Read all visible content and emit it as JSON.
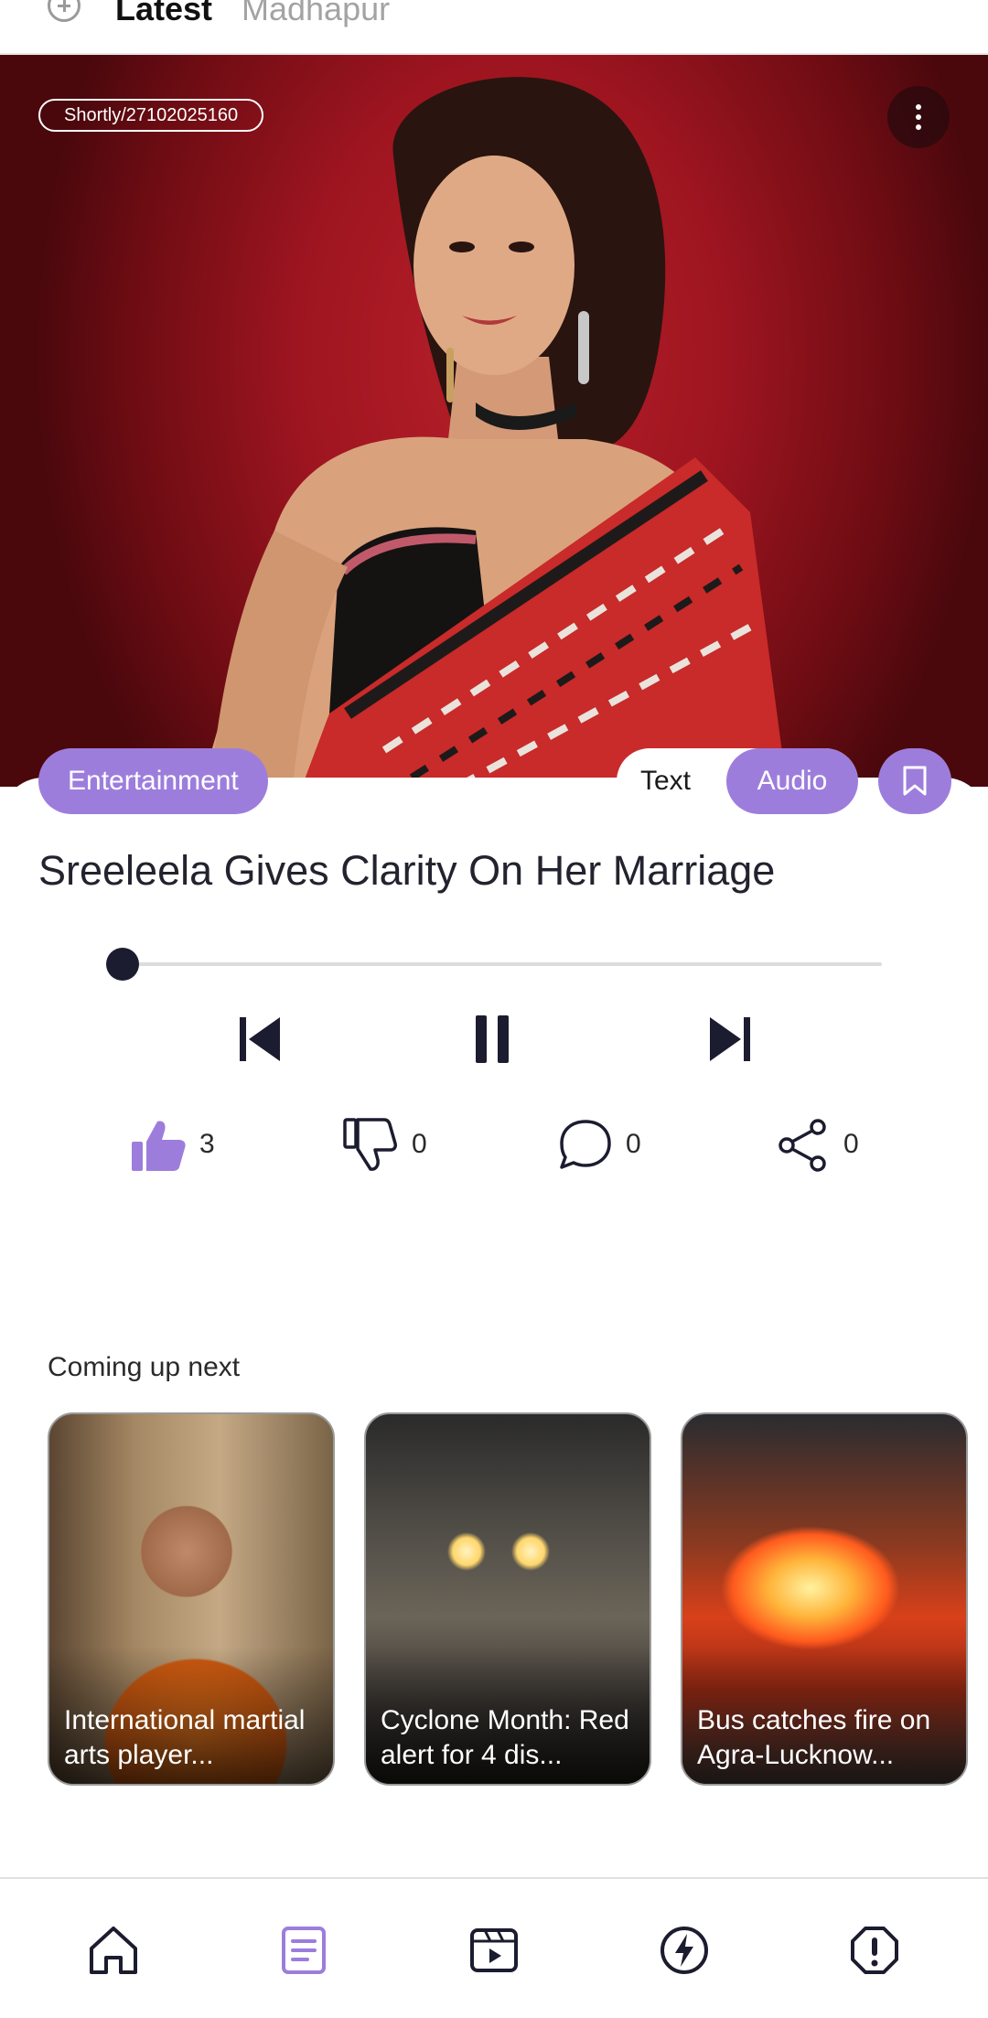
{
  "topbar": {
    "tabs": [
      {
        "label": "Latest",
        "active": true
      },
      {
        "label": "Madhapur",
        "active": false
      }
    ]
  },
  "hero": {
    "source_id": "Shortly/27102025160"
  },
  "article": {
    "category": "Entertainment",
    "headline": "Sreeleela Gives Clarity On Her Marriage",
    "mode_text_label": "Text",
    "mode_audio_label": "Audio",
    "active_mode": "Audio"
  },
  "player": {
    "progress_fraction": 0.0
  },
  "reactions": {
    "likes": "3",
    "dislikes": "0",
    "comments": "0",
    "shares": "0"
  },
  "up_next": {
    "title": "Coming up next",
    "items": [
      {
        "title": "International martial arts player..."
      },
      {
        "title": "Cyclone Month: Red alert for 4 dis..."
      },
      {
        "title": "Bus catches fire on Agra-Lucknow..."
      }
    ]
  },
  "colors": {
    "accent": "#9d7ddc",
    "hero_background": "#9e1520",
    "text_dark": "#23232f"
  },
  "bottom_nav": {
    "items": [
      {
        "icon": "home-icon",
        "active": false
      },
      {
        "icon": "news-icon",
        "active": true
      },
      {
        "icon": "video-icon",
        "active": false
      },
      {
        "icon": "flash-icon",
        "active": false
      },
      {
        "icon": "report-icon",
        "active": false
      }
    ]
  }
}
